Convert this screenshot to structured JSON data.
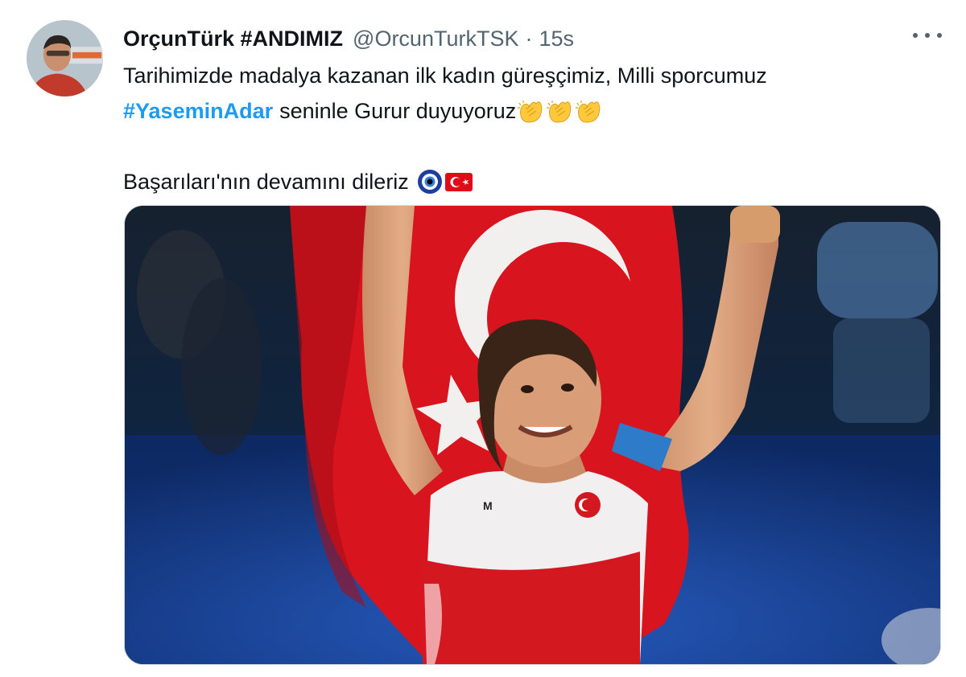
{
  "tweet": {
    "author_name": "OrçunTürk #ANDIMIZ",
    "handle": "@OrcunTurkTSK",
    "separator": "·",
    "timestamp": "15s",
    "line1": "Tarihimizde madalya kazanan ilk kadın güreşçimiz, Milli sporcumuz",
    "hashtag": "#YaseminAdar",
    "line2_rest": "seninle Gurur duyuyoruz",
    "line3": "Başarıları'nın devamını dileriz",
    "emojis_line2": [
      "clapping-hands",
      "clapping-hands",
      "clapping-hands"
    ],
    "emojis_line3": [
      "nazar-amulet",
      "turkey-flag"
    ]
  },
  "media": {
    "kind": "photo",
    "subject": "wrestler celebrating with Turkish flag"
  },
  "colors": {
    "hashtag": "#1d9bf0",
    "text": "#0f1419",
    "secondary": "#536471",
    "flag_red": "#e30a17"
  }
}
